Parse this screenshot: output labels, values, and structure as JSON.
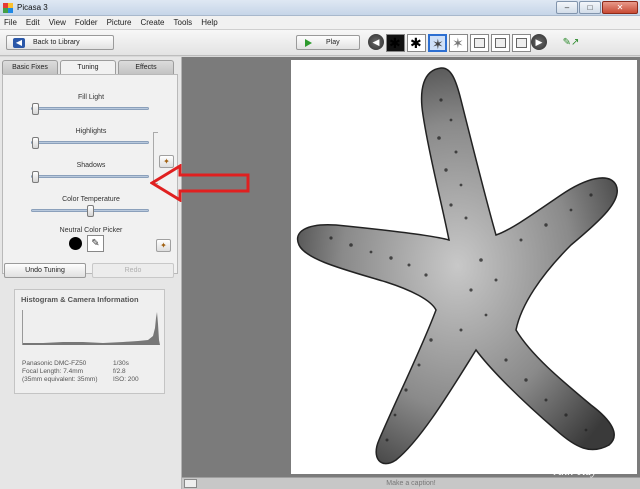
{
  "window": {
    "title": "Picasa 3",
    "minimize": "–",
    "maximize": "□",
    "close": "✕"
  },
  "menu": [
    "File",
    "Edit",
    "View",
    "Folder",
    "Picture",
    "Create",
    "Tools",
    "Help"
  ],
  "toolbar": {
    "back_label": "Back to Library",
    "play_label": "Play",
    "prev_icon": "arrow-left",
    "next_icon": "arrow-right"
  },
  "tabs": [
    {
      "label": "Basic Fixes",
      "active": false
    },
    {
      "label": "Tuning",
      "active": true
    },
    {
      "label": "Effects",
      "active": false
    }
  ],
  "tuning": {
    "fill_light": {
      "label": "Fill Light",
      "level": 0.0
    },
    "highlights": {
      "label": "Highlights",
      "level": 0.0
    },
    "shadows": {
      "label": "Shadows",
      "level": 0.0
    },
    "color_temperature": {
      "label": "Color Temperature",
      "level": 0.5
    },
    "neutral_color_picker": {
      "label": "Neutral Color Picker"
    }
  },
  "buttons": {
    "undo": "Undo Tuning",
    "redo": "Redo"
  },
  "histogram": {
    "title": "Histogram & Camera Information",
    "camera": "Panasonic DMC-FZ50",
    "focal_length": "Focal Length: 7.4mm",
    "equivalent": "(35mm equivalent:  35mm)",
    "shutter": "1/30s",
    "aperture": "f/2.8",
    "iso": "ISO: 200"
  },
  "caption": "Make a caption!",
  "watermark": "Ann-Kay",
  "colors": {
    "annotation_arrow": "#e02020",
    "accent": "#2d6fd1"
  }
}
